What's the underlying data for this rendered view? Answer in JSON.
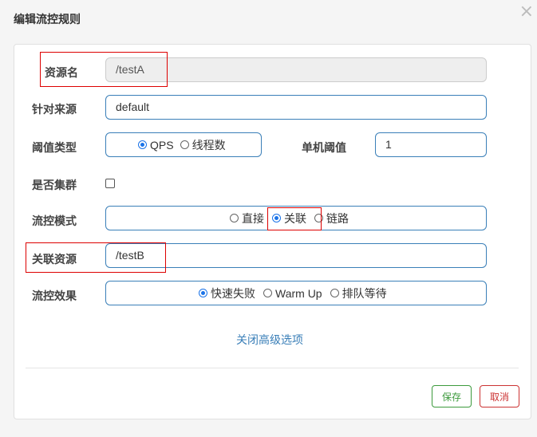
{
  "dialog": {
    "title": "编辑流控规则",
    "close_glyph": "×"
  },
  "form": {
    "resource_name": {
      "label": "资源名",
      "value": "/testA"
    },
    "limit_app": {
      "label": "针对来源",
      "value": "default"
    },
    "threshold_type": {
      "label": "阈值类型",
      "options": [
        "QPS",
        "线程数"
      ],
      "selected": "QPS"
    },
    "single_threshold": {
      "label": "单机阈值",
      "value": "1"
    },
    "cluster_mode": {
      "label": "是否集群",
      "checked": false
    },
    "strategy": {
      "label": "流控模式",
      "options": [
        "直接",
        "关联",
        "链路"
      ],
      "selected": "关联"
    },
    "ref_resource": {
      "label": "关联资源",
      "value": "/testB"
    },
    "control_behavior": {
      "label": "流控效果",
      "options": [
        "快速失败",
        "Warm Up",
        "排队等待"
      ],
      "selected": "快速失败"
    },
    "advanced_toggle": "关闭高级选项"
  },
  "footer": {
    "save_label": "保存",
    "cancel_label": "取消"
  },
  "colors": {
    "accent": "#3a7fb8",
    "radio_checked": "#1a73e8",
    "highlight_box": "#dd0000",
    "save": "#3c9a3c",
    "cancel": "#cc3333"
  }
}
